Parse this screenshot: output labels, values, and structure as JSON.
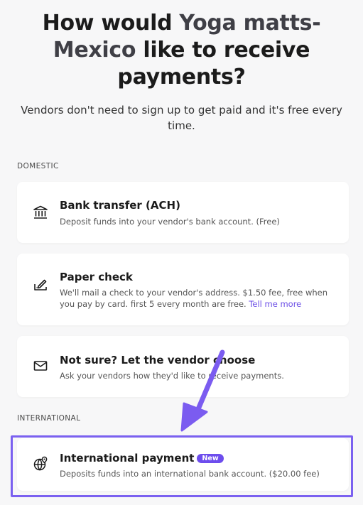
{
  "heading": {
    "part1": "How would ",
    "vendor": "Yoga matts-Mexico",
    "part2": " like to receive payments?"
  },
  "subtitle": "Vendors don't need to sign up to get paid and it's free every time.",
  "sections": {
    "domestic_label": "DOMESTIC",
    "international_label": "INTERNATIONAL"
  },
  "options": {
    "ach": {
      "title": "Bank transfer (ACH)",
      "description": "Deposit funds into your vendor's bank account. (Free)"
    },
    "check": {
      "title": "Paper check",
      "description": "We'll mail a check to your vendor's address. $1.50 fee, free when you pay by card. first 5 every month are free.",
      "link": "Tell me more"
    },
    "unsure": {
      "title": "Not sure? Let the vendor choose",
      "description": "Ask your vendors how they'd like to receive payments."
    },
    "international": {
      "title": "International payment",
      "badge": "New",
      "description": "Deposits funds into an international bank account. ($20.00 fee)"
    }
  },
  "colors": {
    "accent": "#6d4ded",
    "highlight": "#7b61f0",
    "background": "#f7f7f8",
    "link": "#6b4ee6"
  },
  "icons": {
    "ach": "bank-icon",
    "check": "check-pen-icon",
    "unsure": "envelope-icon",
    "international": "globe-location-icon"
  }
}
